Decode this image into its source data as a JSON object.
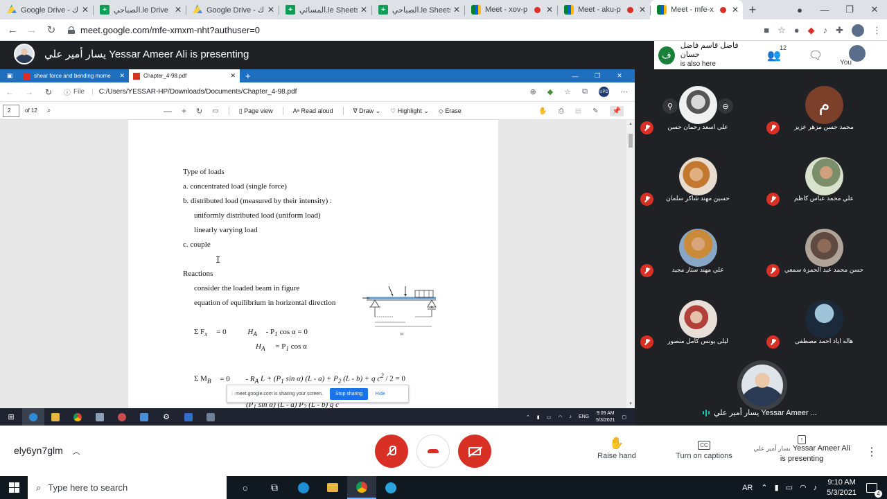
{
  "browser": {
    "tabs": [
      {
        "title": "Google Drive - اك",
        "icon": "drive"
      },
      {
        "title": "الصباحي.le Drive",
        "icon": "sheets"
      },
      {
        "title": "Google Drive - اك",
        "icon": "drive"
      },
      {
        "title": "المسائي.le Sheets",
        "icon": "sheets"
      },
      {
        "title": "الصباحي.le Sheets",
        "icon": "sheets"
      },
      {
        "title": "Meet - xov-p",
        "icon": "meet"
      },
      {
        "title": "Meet - aku-p",
        "icon": "meet"
      },
      {
        "title": "Meet - mfe-x",
        "icon": "meet"
      }
    ],
    "url": "meet.google.com/mfe-xmxm-nht?authuser=0"
  },
  "header": {
    "presenter_text": "يسار أمير علي Yessar Ameer Ali is presenting",
    "also_here_name": "فاضل قاسم فاضل حسان",
    "also_here_text": "is also here",
    "also_here_initial": "ف",
    "participant_count": "12",
    "you_label": "You"
  },
  "shared_screen": {
    "edge_tabs": [
      "shear force and bending mome",
      "Chapter_4-98.pdf"
    ],
    "file_label": "File",
    "path": "C:/Users/YESSAR-HP/Downloads/Documents/Chapter_4-98.pdf",
    "page_number": "2",
    "page_total": "of 12",
    "tools": {
      "page_view": "Page view",
      "read_aloud": "Read aloud",
      "draw": "Draw",
      "highlight": "Highlight",
      "erase": "Erase"
    },
    "doc": {
      "heading1": "Type of loads",
      "line_a": "a. concentrated load (single force)",
      "line_b": "b. distributed load (measured by their intensity) :",
      "line_b1": "uniformly distributed load (uniform load)",
      "line_b2": "linearly varying load",
      "line_c": "c. couple",
      "heading2": "Reactions",
      "line_r1": "consider the loaded beam in figure",
      "line_r2": "equation of equilibrium in horizontal direction",
      "eq1_lhs": "Σ F",
      "eq1_sub": "x",
      "eq1_eq": "=  0",
      "eq1_rhs": "H",
      "eq1_rhs_sub": "A",
      "eq1_rest": "-  P",
      "eq1_rest_sub": "1",
      "eq1_cos": "cos α  =  0",
      "eq2_lhs": "H",
      "eq2_lhs_sub": "A",
      "eq2_rhs": "=  P",
      "eq2_rhs_sub": "1",
      "eq2_cos": "cos α",
      "eq3_lhs": "Σ M",
      "eq3_sub": "B",
      "eq3_eq": "=  0",
      "eq3_rhs": "- R",
      "eq3_rhs_sub": "A",
      "eq3_rest": "L + (P",
      "eq3_rest_sub": "1",
      "eq3_rest2": "sin α) (L - a) + P",
      "eq3_rest2_sub": "2",
      "eq3_rest3": "(L - b) + q c",
      "eq3_sup": "2",
      "eq3_end": "/ 2 = 0",
      "eq4_partial": "(P",
      "eq4_partial_sub": "1",
      "eq4_partial_rest": "sin α) (L - a)          P",
      "eq4_partial_sub2": "2",
      "eq4_partial_rest2": "(L - b)          q c",
      "fig_label": "(a)"
    },
    "share_notice": "meet.google.com is sharing your screen.",
    "stop_sharing": "Stop sharing",
    "hide": "Hide",
    "taskbar_time": "9:09 AM",
    "taskbar_date": "5/3/2021",
    "taskbar_lang": "ENG"
  },
  "participants": [
    {
      "name": "محمد حسن مزهر عزيز",
      "initial": "م"
    },
    {
      "name": "علي اسعد رحمان حسن"
    },
    {
      "name": "علي محمد عباس كاظم"
    },
    {
      "name": "حسين مهند شاكر سلمان"
    },
    {
      "name": "حسن محمد عبد الحمزة سمعي"
    },
    {
      "name": "علي مهند ستار مجيد"
    },
    {
      "name": "هاله اياد احمد مصطفى"
    },
    {
      "name": "ليلى يونس كامل منصور"
    }
  ],
  "self_tile": {
    "name": "يسار أمير علي Yessar Ameer ..."
  },
  "controls": {
    "meeting_code": "ely6yn7glm",
    "raise_hand": "Raise hand",
    "captions": "Turn on captions",
    "presenter_ar": "يسار أمير علي",
    "presenter_en": "Yessar Ameer Ali",
    "presenting": "is presenting"
  },
  "taskbar": {
    "search_placeholder": "Type here to search",
    "lang": "AR",
    "time": "9:10 AM",
    "date": "5/3/2021"
  },
  "colors": {
    "meet_dark": "#202124",
    "danger_red": "#d93025",
    "edge_blue": "#1e6fc0",
    "google_blue": "#1a73e8"
  }
}
